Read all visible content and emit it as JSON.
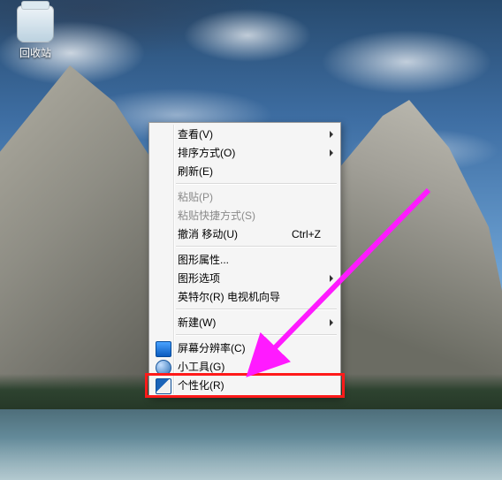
{
  "desktop": {
    "icons": {
      "recycle_bin": {
        "label": "回收站"
      }
    }
  },
  "context_menu": {
    "items": [
      {
        "id": "view",
        "label": "查看(V)",
        "submenu": true,
        "enabled": true
      },
      {
        "id": "sort",
        "label": "排序方式(O)",
        "submenu": true,
        "enabled": true
      },
      {
        "id": "refresh",
        "label": "刷新(E)",
        "submenu": false,
        "enabled": true
      },
      {
        "sep": true
      },
      {
        "id": "paste",
        "label": "粘贴(P)",
        "submenu": false,
        "enabled": false
      },
      {
        "id": "paste_shortcut",
        "label": "粘贴快捷方式(S)",
        "submenu": false,
        "enabled": false
      },
      {
        "id": "undo_move",
        "label": "撤消 移动(U)",
        "shortcut": "Ctrl+Z",
        "submenu": false,
        "enabled": true
      },
      {
        "sep": true
      },
      {
        "id": "gfx_props",
        "label": "图形属性...",
        "submenu": false,
        "enabled": true
      },
      {
        "id": "gfx_options",
        "label": "图形选项",
        "submenu": true,
        "enabled": true
      },
      {
        "id": "intel_tv",
        "label": "英特尔(R) 电视机向导",
        "submenu": false,
        "enabled": true
      },
      {
        "sep": true
      },
      {
        "id": "new",
        "label": "新建(W)",
        "submenu": true,
        "enabled": true
      },
      {
        "sep": true
      },
      {
        "id": "resolution",
        "label": "屏幕分辨率(C)",
        "icon": "ic-screen",
        "submenu": false,
        "enabled": true
      },
      {
        "id": "gadgets",
        "label": "小工具(G)",
        "icon": "ic-gadget",
        "submenu": false,
        "enabled": true
      },
      {
        "id": "personalize",
        "label": "个性化(R)",
        "icon": "ic-personalize",
        "submenu": false,
        "enabled": true,
        "highlighted": true
      }
    ]
  },
  "annotation": {
    "arrow_color": "#ff1aff",
    "highlight_color": "#ff1a1a"
  }
}
